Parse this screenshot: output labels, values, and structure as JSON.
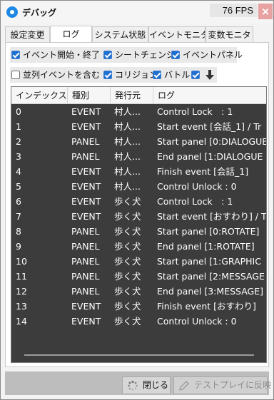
{
  "window": {
    "title": "デバッグ",
    "fps": "76 FPS",
    "close_label": "×"
  },
  "tabs": [
    {
      "label": "設定変更",
      "active": false
    },
    {
      "label": "ログ",
      "active": true
    },
    {
      "label": "システム状態",
      "active": false
    },
    {
      "label": "イベントモニタ",
      "active": false
    },
    {
      "label": "変数モニタ",
      "active": false
    }
  ],
  "options": {
    "event_start_end": {
      "label": "イベント開始・終了",
      "checked": true
    },
    "scene_change": {
      "label": "シートチェンジ",
      "checked": true
    },
    "event_panel": {
      "label": "イベントパネル",
      "checked": true
    },
    "parallel_events": {
      "label": "並列イベントを含む",
      "checked": false
    },
    "collision": {
      "label": "コリジョン",
      "checked": true
    },
    "battle": {
      "label": "バトル",
      "checked": true
    },
    "auto_scroll": {
      "checked": true,
      "icon": "down-arrow-icon"
    }
  },
  "log": {
    "columns": [
      "インデックス",
      "種別",
      "発行元",
      "ログ"
    ],
    "rows": [
      {
        "index": "0",
        "type": "EVENT",
        "source": "村人...",
        "message": "Control Lock　: 1"
      },
      {
        "index": "1",
        "type": "EVENT",
        "source": "村人...",
        "message": "Start event [会話_1] / Tr"
      },
      {
        "index": "2",
        "type": "PANEL",
        "source": "村人...",
        "message": "Start panel [0:DIALOGUE"
      },
      {
        "index": "3",
        "type": "PANEL",
        "source": "村人...",
        "message": "End panel [1:DIALOGUE"
      },
      {
        "index": "4",
        "type": "EVENT",
        "source": "村人...",
        "message": "Finish event [会話_1]"
      },
      {
        "index": "5",
        "type": "EVENT",
        "source": "村人...",
        "message": "Control Unlock : 0"
      },
      {
        "index": "6",
        "type": "EVENT",
        "source": "歩く犬",
        "message": "Control Lock　: 1"
      },
      {
        "index": "7",
        "type": "EVENT",
        "source": "歩く犬",
        "message": "Start event [おすわり] / Tr"
      },
      {
        "index": "8",
        "type": "PANEL",
        "source": "歩く犬",
        "message": "Start panel [0:ROTATE]"
      },
      {
        "index": "9",
        "type": "PANEL",
        "source": "歩く犬",
        "message": "End panel [1:ROTATE]"
      },
      {
        "index": "10",
        "type": "PANEL",
        "source": "歩く犬",
        "message": "Start panel [1:GRAPHIC"
      },
      {
        "index": "11",
        "type": "PANEL",
        "source": "歩く犬",
        "message": "Start panel [2:MESSAGE"
      },
      {
        "index": "12",
        "type": "PANEL",
        "source": "歩く犬",
        "message": "End panel [3:MESSAGE]"
      },
      {
        "index": "13",
        "type": "EVENT",
        "source": "歩く犬",
        "message": "Finish event [おすわり]"
      },
      {
        "index": "14",
        "type": "EVENT",
        "source": "歩く犬",
        "message": "Control Unlock : 0"
      }
    ]
  },
  "footer": {
    "close_button": "閉じる",
    "apply_button": "テストプレイに反映"
  },
  "colors": {
    "accent": "#1f6fd1",
    "close": "#e8a1a1",
    "log_background": "#3c3c3c"
  }
}
